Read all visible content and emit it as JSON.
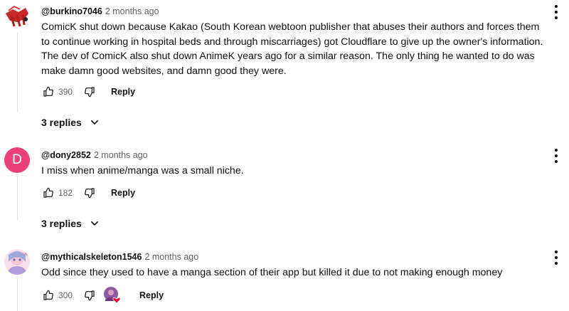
{
  "comments": [
    {
      "author": "@burkino7046",
      "time": "2 months ago",
      "text_lines": [
        "ComicK shut down because Kakao (South Korean webtoon publisher that abuses their authors and forces them to continue working in hospital beds and through miscarriages) got Cloudflare to give up the owner's information.",
        "The dev of ComicK also shut down AnimeK years ago for a similar reason. The only thing he wanted to do was make damn good websites, and damn good they were."
      ],
      "likes": "390",
      "reply_label": "Reply",
      "replies_label": "3 replies",
      "avatar_icon": "red-abstract-avatar"
    },
    {
      "author": "@dony2852",
      "time": "2 months ago",
      "text_lines": [
        "I miss when anime/manga was a small niche."
      ],
      "likes": "182",
      "reply_label": "Reply",
      "replies_label": "3 replies",
      "avatar_letter": "D",
      "avatar_color": "#ec407a"
    },
    {
      "author": "@mythicalskeleton1546",
      "time": "2 months ago",
      "text_lines": [
        "Odd since they used to have a manga section of their app but killed it due to not making enough money"
      ],
      "likes": "300",
      "reply_label": "Reply",
      "avatar_icon": "anime-character-avatar",
      "creator_heart_icon": "creator-heart-icon"
    }
  ]
}
